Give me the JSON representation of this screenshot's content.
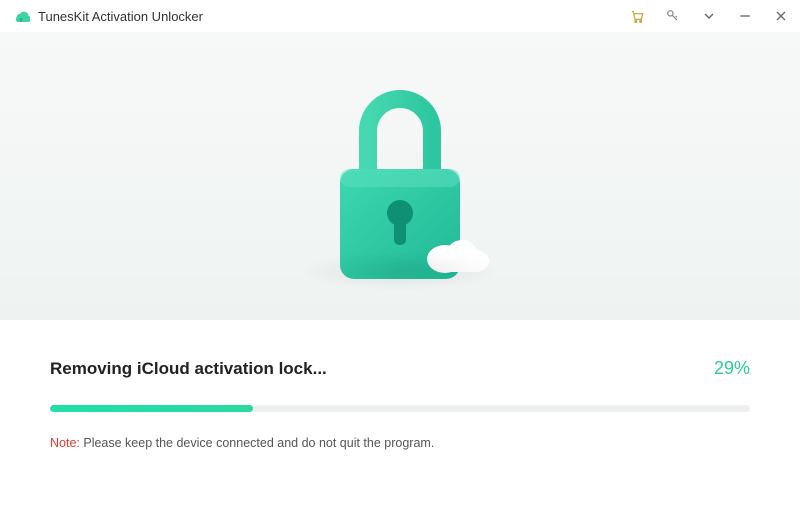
{
  "titlebar": {
    "app_title": "TunesKit Activation Unlocker"
  },
  "progress": {
    "title": "Removing iCloud activation lock...",
    "percent_text": "29%",
    "percent_value": 29
  },
  "note": {
    "label": "Note:",
    "text": " Please keep the device connected and do not quit the program."
  }
}
